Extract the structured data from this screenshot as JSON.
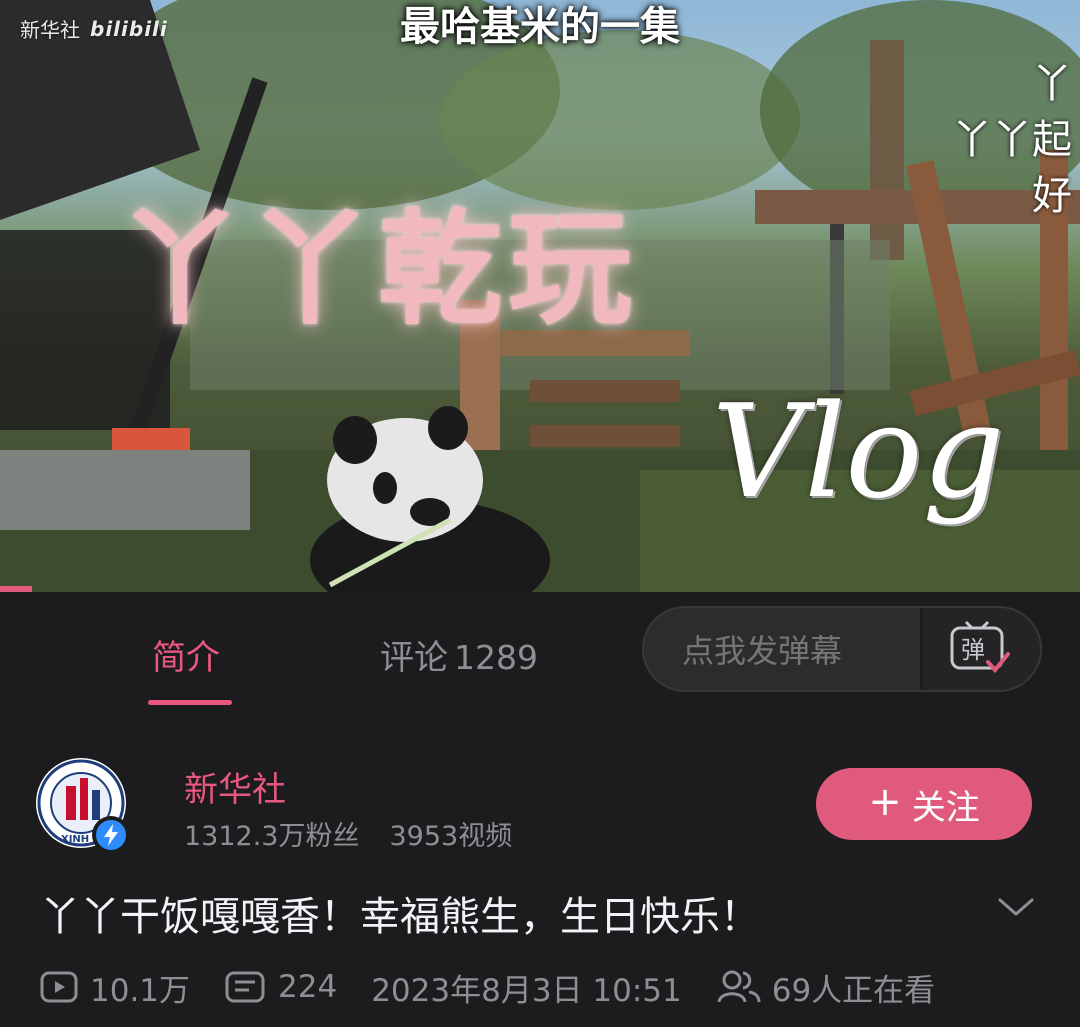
{
  "video": {
    "watermark_source": "新华社",
    "watermark_platform": "bilibili",
    "subtitle": "最哈基米的一集",
    "side_danmaku": [
      "丫",
      "丫丫起",
      "好"
    ],
    "overlay_title": "丫丫乾玩",
    "overlay_vlog": "Vlog",
    "progress_fraction": 0.03
  },
  "tabs": {
    "intro_label": "简介",
    "comments_label": "评论",
    "comments_count": "1289"
  },
  "danmaku": {
    "placeholder": "点我发弹幕",
    "button_icon": "danmaku-toggle-icon",
    "button_glyph": "弹"
  },
  "uploader": {
    "name": "新华社",
    "fans": "1312.3万粉丝",
    "videos": "3953视频",
    "avatar_text": "XINH",
    "follow_label": "关注"
  },
  "title": "丫丫干饭嘎嘎香！幸福熊生，生日快乐！",
  "meta": {
    "plays": "10.1万",
    "danmaku_count": "224",
    "datetime": "2023年8月3日 10:51",
    "watching": "69人正在看"
  },
  "colors": {
    "accent": "#e05a7d",
    "background": "#1c1c1e",
    "muted": "#8e8e93"
  }
}
